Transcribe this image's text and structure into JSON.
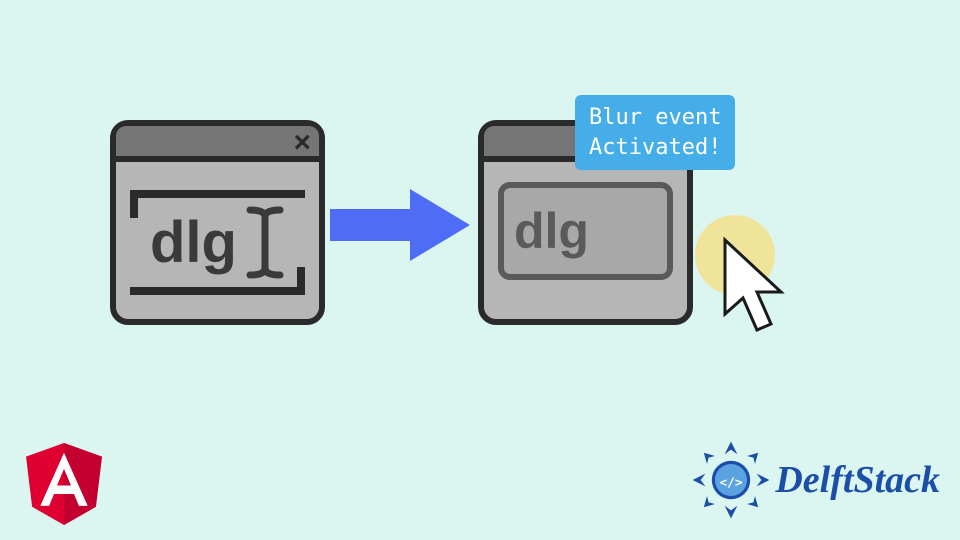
{
  "diagram": {
    "left_window": {
      "close_label": "×",
      "input_value": "dlg",
      "focused": true
    },
    "right_window": {
      "close_label": "",
      "input_value": "dlg",
      "focused": false
    },
    "tooltip_line1": "Blur event",
    "tooltip_line2": "Activated!"
  },
  "logos": {
    "angular_letter": "A",
    "delftstack_text": "DelftStack"
  },
  "colors": {
    "background": "#dbf6f0",
    "arrow": "#4f6cf7",
    "tooltip_bg": "#45aee8",
    "angular_red": "#dd0031",
    "delft_blue": "#1b4ea8"
  }
}
